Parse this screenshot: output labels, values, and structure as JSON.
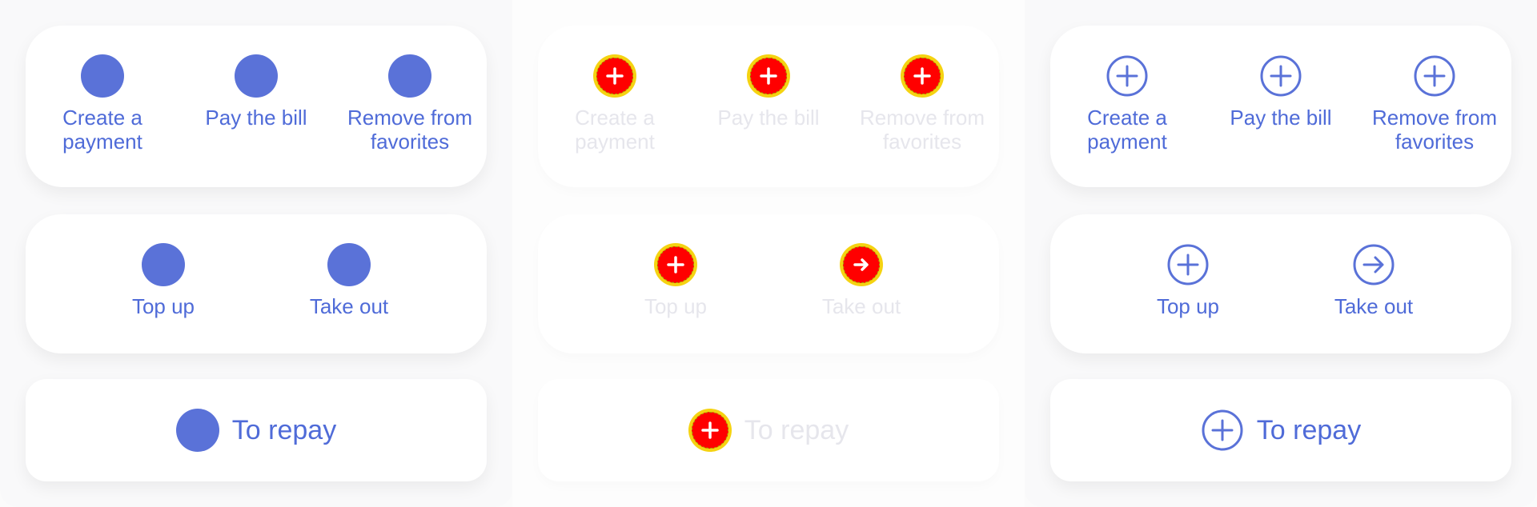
{
  "columns": [
    {
      "row1": [
        "Create a\npayment",
        "Pay the bill",
        "Remove from\nfavorites"
      ],
      "row2": [
        "Top up",
        "Take out"
      ],
      "row3": "To repay"
    },
    {
      "row1": [
        "Create a\npayment",
        "Pay the bill",
        "Remove from\nfavorites"
      ],
      "row2": [
        "Top up",
        "Take out"
      ],
      "row3": "To repay"
    },
    {
      "row1": [
        "Create a\npayment",
        "Pay the bill",
        "Remove from\nfavorites"
      ],
      "row2": [
        "Top up",
        "Take out"
      ],
      "row3": "To repay"
    }
  ],
  "icons": {
    "col1": "circle-icon",
    "col2": [
      "plus-circle-icon",
      "arrow-right-circle-icon"
    ],
    "col3": [
      "plus-circle-icon",
      "arrow-right-circle-icon"
    ]
  },
  "colors": {
    "accent": "#5a72d8",
    "highlight_red": "#ff0000",
    "highlight_yellow": "#f5d311",
    "muted_text": "#e6e6ec"
  }
}
